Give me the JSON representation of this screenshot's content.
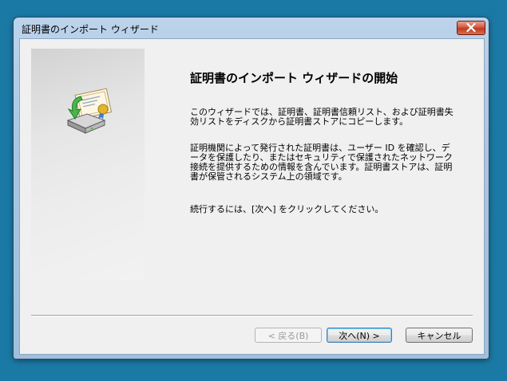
{
  "window": {
    "title": "証明書のインポート ウィザード"
  },
  "content": {
    "heading": "証明書のインポート ウィザードの開始",
    "paragraph1": "このウィザードでは、証明書、証明書信頼リスト、および証明書失効リストをディスクから証明書ストアにコピーします。",
    "paragraph2": "証明機関によって発行された証明書は、ユーザー ID を確認し、データを保護したり、またはセキュリティで保護されたネットワーク接続を提供するための情報を含んでいます。証明書ストアは、証明書が保管されるシステム上の領域です。",
    "paragraph3": "続行するには、[次へ] をクリックしてください。"
  },
  "buttons": {
    "back": "< 戻る(B)",
    "next": "次へ(N) >",
    "cancel": "キャンセル"
  },
  "icons": {
    "close": "close-icon",
    "certificate": "certificate-import-icon"
  },
  "colors": {
    "desktop": "#1b7aa5",
    "close_button": "#c0391f",
    "dialog_background": "#f0f0f0"
  }
}
